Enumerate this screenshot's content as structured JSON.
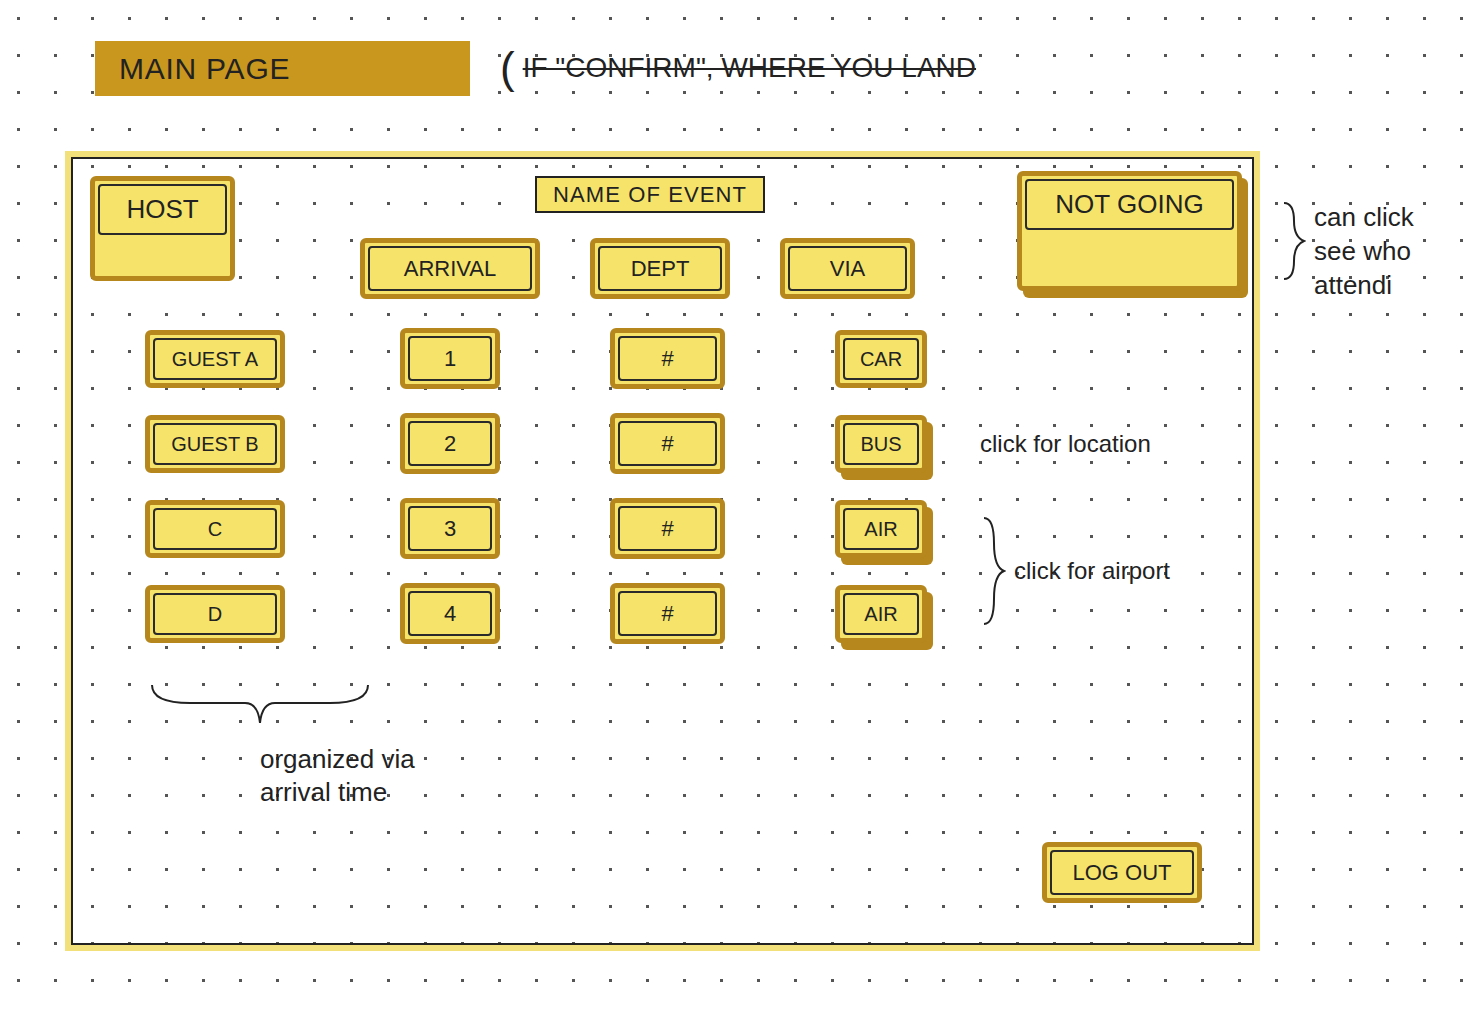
{
  "page": {
    "title": "MAIN PAGE",
    "note_open": "(",
    "note": "IF \"CONFIRM\", WHERE YOU LAND",
    "note_struck": true
  },
  "event": {
    "name": "NAME OF EVENT"
  },
  "host_button": "HOST",
  "not_going": {
    "label": "NOT GOING",
    "note": [
      "can click",
      "see who",
      "attendi"
    ]
  },
  "columns": [
    "ARRIVAL",
    "DEPT",
    "VIA"
  ],
  "rows": [
    {
      "guest": "GUEST A",
      "arrival": "1",
      "dept": "#",
      "via": "CAR",
      "clickable": false
    },
    {
      "guest": "GUEST B",
      "arrival": "2",
      "dept": "#",
      "via": "BUS",
      "clickable": true
    },
    {
      "guest": "C",
      "arrival": "3",
      "dept": "#",
      "via": "AIR",
      "clickable": true
    },
    {
      "guest": "D",
      "arrival": "4",
      "dept": "#",
      "via": "AIR",
      "clickable": true
    }
  ],
  "via_notes": [
    {
      "text": "click for location",
      "brace": false
    },
    {
      "text": "click for airport",
      "brace": true
    }
  ],
  "sort_note": [
    "organized via",
    "arrival time"
  ],
  "logout": "LOG OUT"
}
